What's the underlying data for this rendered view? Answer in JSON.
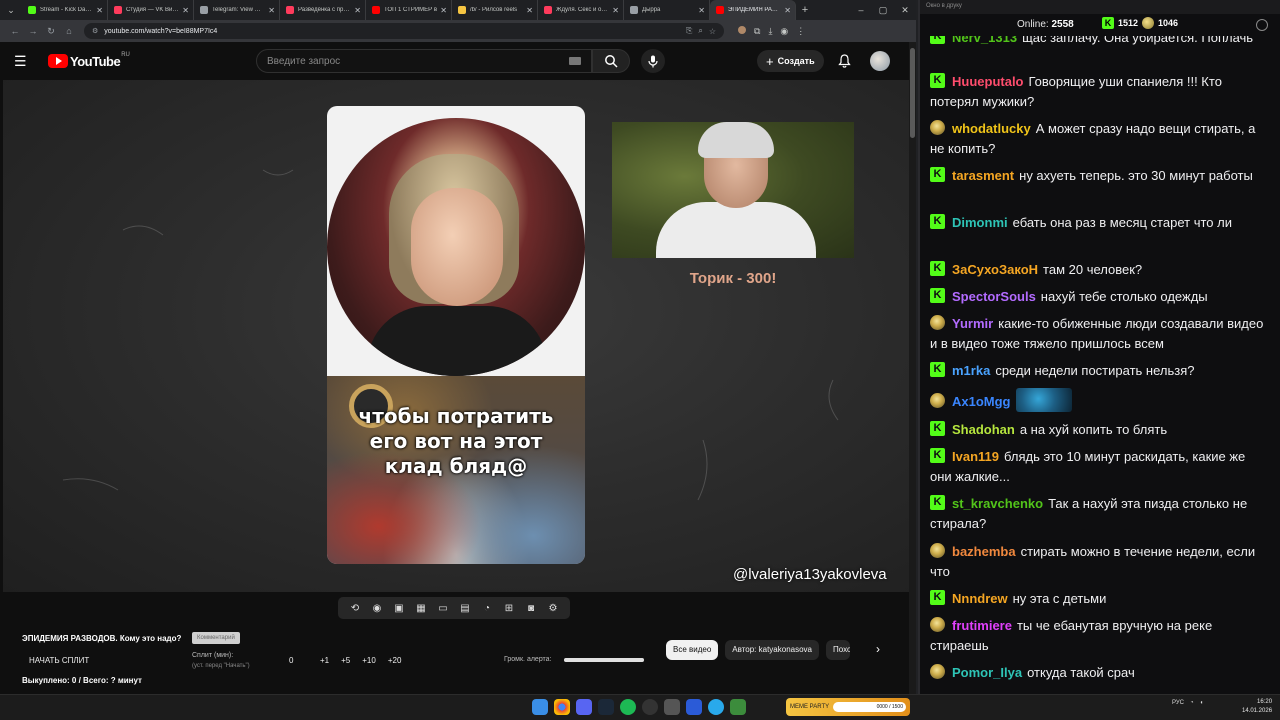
{
  "browser": {
    "tabs": [
      {
        "title": "Stream - Kick Dashb",
        "color": "#53fc18"
      },
      {
        "title": "Студия — VK Видео",
        "color": "#ff3b5c"
      },
      {
        "title": "Telegram: View @Pid",
        "color": "#9aa0a6"
      },
      {
        "title": "Разведёнка с прице",
        "color": "#ff3b5c"
      },
      {
        "title": "ТОП 1 СТРИМЕР в",
        "color": "#ff0000"
      },
      {
        "title": "/b/ - Рилсов reels",
        "color": "#f5c542"
      },
      {
        "title": "Ждуля. Секс и отно",
        "color": "#ff3b5c"
      },
      {
        "title": "Дырра",
        "color": "#9aa0a6"
      },
      {
        "title": "ЭПИДЕМИЯ РАЗВО",
        "color": "#ff0000",
        "active": true
      }
    ],
    "url": "youtube.com/watch?v=beI88MP7Ic4"
  },
  "youtube": {
    "country": "RU",
    "logo_text": "YouTube",
    "search_placeholder": "Введите запрос",
    "create_label": "Создать",
    "video": {
      "caption": "чтобы потратить\nего вот на этот\nклад бляд@",
      "side_caption": "Торик - 300!",
      "watermark": "@lvaleriya13yakovleva"
    },
    "panel": {
      "title": "ЭПИДЕМИЯ РАЗВОДОВ. Кому это надо?",
      "chip_small": "Комментарий",
      "start_button": "НАЧАТЬ СПЛИТ",
      "split_label": "Сплит (мин):",
      "split_sub": "(уст. перед \"Начать\")",
      "split_value": "0",
      "increments": [
        "+1",
        "+5",
        "+10",
        "+20"
      ],
      "alert_label": "Громк. алерта:",
      "alert_level": 1.0,
      "bought": "Выкуплено: 0 / Всего: ? минут"
    },
    "chips": [
      "Все видео",
      "Автор: katyakonasova",
      "Похо"
    ]
  },
  "chat": {
    "window_title": "Окно в друку",
    "online_label": "Online:",
    "online_count": "2558",
    "kick_count": "1512",
    "points_count": "1046",
    "messages": [
      {
        "badge": "k",
        "user": "Nerv_1313",
        "color": "#52c41a",
        "text": "щас заплачу. Она убирается. Поплачь"
      },
      {
        "badge": "k",
        "user": "Huueputalo",
        "color": "#ff4d6d",
        "text": "Говорящие уши спаниеля !!! Кто потерял мужики?"
      },
      {
        "badge": "p",
        "user": "whodatlucky",
        "color": "#f0c419",
        "text": "А может сразу надо вещи стирать, а не копить?"
      },
      {
        "badge": "k",
        "user": "tarasment",
        "color": "#f5a623",
        "text": "ну ахуеть теперь. это 30 минут работы"
      },
      {
        "badge": "k",
        "user": "Dimonmi",
        "color": "#2ec4b6",
        "text": "ебать она раз в месяц старет что ли"
      },
      {
        "badge": "k",
        "user": "ЗаСухоЗакоН",
        "color": "#f5a623",
        "text": "там 20 человек?"
      },
      {
        "badge": "k",
        "user": "SpectorSouls",
        "color": "#b36bff",
        "text": "нахуй тебе столько одежды"
      },
      {
        "badge": "p",
        "user": "Yurmir",
        "color": "#b36bff",
        "text": "какие-то обиженные люди создавали видео и в видео тоже тяжело пришлось всем"
      },
      {
        "badge": "k",
        "user": "m1rka",
        "color": "#4aa3ff",
        "text": "среди недели постирать нельзя?"
      },
      {
        "badge": "p",
        "user": "Ax1oMgg",
        "color": "#3a86ff",
        "text": "",
        "emote": "blue-creature"
      },
      {
        "badge": "k",
        "user": "Shadohan",
        "color": "#b6e63e",
        "text": "а на хуй копить то блять"
      },
      {
        "badge": "k",
        "user": "Ivan119",
        "color": "#f5a623",
        "text": "блядь это 10 минут раскидать, какие же они жалкие..."
      },
      {
        "badge": "k",
        "user": "st_kravchenko",
        "color": "#52c41a",
        "text": "Так а нахуй эта пизда столько не стирала?"
      },
      {
        "badge": "p",
        "user": "bazhemba",
        "color": "#f0883e",
        "text": "стирать можно в течение недели, если что"
      },
      {
        "badge": "k",
        "user": "Nnndrew",
        "color": "#f5a623",
        "text": "ну эта с детьми"
      },
      {
        "badge": "p",
        "user": "frutimiere",
        "color": "#e040fb",
        "text": "ты че ебанутая вручную на реке стираешь"
      },
      {
        "badge": "p",
        "user": "Pomor_Ilya",
        "color": "#2ec4b6",
        "text": "откуда такой срач"
      }
    ]
  },
  "taskbar": {
    "ad_text": "MEME PARTY",
    "ad_counter": "0000 / 1500",
    "lang": "РУС",
    "time": "16:20",
    "date": "14.01.2026"
  }
}
